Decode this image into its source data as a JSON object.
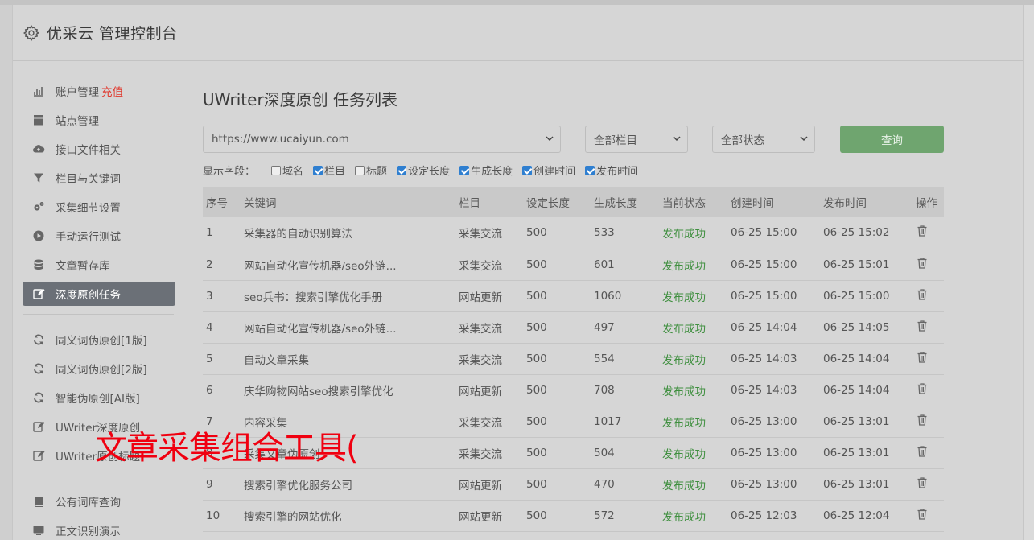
{
  "header": {
    "title": "优采云 管理控制台",
    "icon": "gear-icon"
  },
  "sidebar": {
    "groups": [
      [
        {
          "label": "账户管理",
          "badge": "充值",
          "icon": "bar-chart-icon"
        },
        {
          "label": "站点管理",
          "icon": "server-icon"
        },
        {
          "label": "接口文件相关",
          "icon": "cloud-upload-icon"
        },
        {
          "label": "栏目与关键词",
          "icon": "filter-icon"
        },
        {
          "label": "采集细节设置",
          "icon": "gears-icon"
        },
        {
          "label": "手动运行测试",
          "icon": "play-circle-icon"
        },
        {
          "label": "文章暂存库",
          "icon": "database-icon"
        },
        {
          "label": "深度原创任务",
          "icon": "edit-icon",
          "active": true
        }
      ],
      [
        {
          "label": "同义词伪原创[1版]",
          "icon": "refresh-icon"
        },
        {
          "label": "同义词伪原创[2版]",
          "icon": "refresh-icon"
        },
        {
          "label": "智能伪原创[AI版]",
          "icon": "refresh-icon"
        },
        {
          "label": "UWriter深度原创",
          "icon": "edit-icon"
        },
        {
          "label": "UWriter原创标题",
          "icon": "edit-icon"
        }
      ],
      [
        {
          "label": "公有词库查询",
          "icon": "book-icon"
        },
        {
          "label": "正文识别演示",
          "icon": "monitor-icon"
        }
      ]
    ]
  },
  "main": {
    "title": "UWriter深度原创 任务列表",
    "site_select": "https://www.ucaiyun.com",
    "column_select": "全部栏目",
    "status_select": "全部状态",
    "query_label": "查询",
    "fields_label": "显示字段：",
    "fields": [
      {
        "label": "域名",
        "checked": false
      },
      {
        "label": "栏目",
        "checked": true
      },
      {
        "label": "标题",
        "checked": false
      },
      {
        "label": "设定长度",
        "checked": true
      },
      {
        "label": "生成长度",
        "checked": true
      },
      {
        "label": "创建时间",
        "checked": true
      },
      {
        "label": "发布时间",
        "checked": true
      }
    ],
    "columns": [
      "序号",
      "关键词",
      "栏目",
      "设定长度",
      "生成长度",
      "当前状态",
      "创建时间",
      "发布时间",
      "操作"
    ],
    "rows": [
      [
        "1",
        "采集器的自动识别算法",
        "采集交流",
        "500",
        "533",
        "发布成功",
        "06-25 15:00",
        "06-25 15:02"
      ],
      [
        "2",
        "网站自动化宣传机器/seo外链...",
        "采集交流",
        "500",
        "601",
        "发布成功",
        "06-25 15:00",
        "06-25 15:01"
      ],
      [
        "3",
        "seo兵书：搜索引擎优化手册",
        "网站更新",
        "500",
        "1060",
        "发布成功",
        "06-25 15:00",
        "06-25 15:00"
      ],
      [
        "4",
        "网站自动化宣传机器/seo外链...",
        "采集交流",
        "500",
        "497",
        "发布成功",
        "06-25 14:04",
        "06-25 14:05"
      ],
      [
        "5",
        "自动文章采集",
        "采集交流",
        "500",
        "554",
        "发布成功",
        "06-25 14:03",
        "06-25 14:04"
      ],
      [
        "6",
        "庆华购物网站seo搜索引擎优化",
        "网站更新",
        "500",
        "708",
        "发布成功",
        "06-25 14:03",
        "06-25 14:04"
      ],
      [
        "7",
        "内容采集",
        "采集交流",
        "500",
        "1017",
        "发布成功",
        "06-25 13:00",
        "06-25 13:01"
      ],
      [
        "8",
        "采集文章伪原创",
        "采集交流",
        "500",
        "504",
        "发布成功",
        "06-25 13:00",
        "06-25 13:01"
      ],
      [
        "9",
        "搜索引擎优化服务公司",
        "网站更新",
        "500",
        "470",
        "发布成功",
        "06-25 13:00",
        "06-25 13:01"
      ],
      [
        "10",
        "搜索引擎的网站优化",
        "网站更新",
        "500",
        "572",
        "发布成功",
        "06-25 12:03",
        "06-25 12:04"
      ]
    ]
  },
  "overlay_text": "文章采集组合工具(",
  "colors": {
    "active_nav": "#6b7077",
    "query_button": "#6fa56f",
    "status_success": "#3f8f3f",
    "badge": "#e0392e",
    "overlay": "#f00010"
  }
}
